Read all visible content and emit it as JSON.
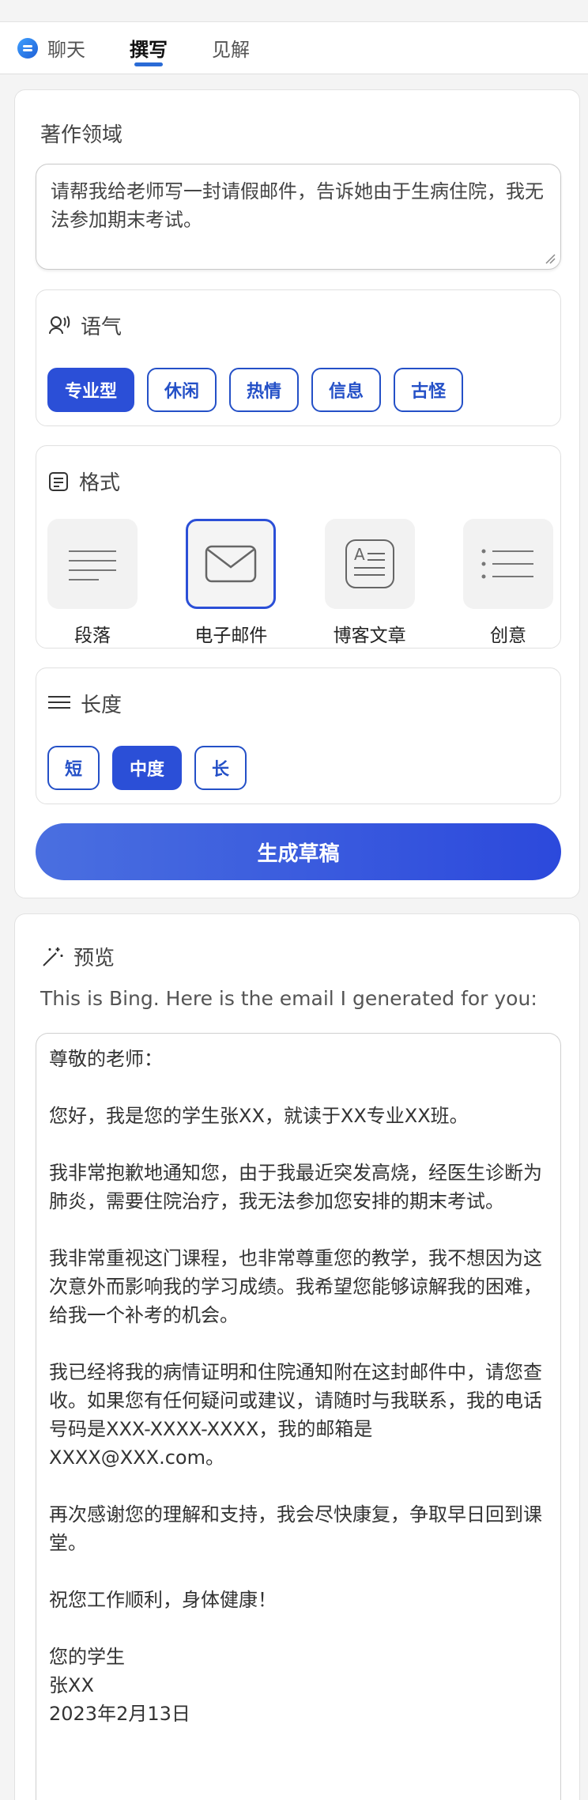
{
  "tabs": [
    {
      "label": "聊天",
      "icon": "chat-bubble-icon"
    },
    {
      "label": "撰写"
    },
    {
      "label": "见解"
    }
  ],
  "compose": {
    "topic_title": "著作领域",
    "topic_text": "请帮我给老师写一封请假邮件，告诉她由于生病住院，我无法参加期末考试。",
    "tone": {
      "title": "语气",
      "options": [
        "专业型",
        "休闲",
        "热情",
        "信息",
        "古怪"
      ],
      "selected": "专业型"
    },
    "format": {
      "title": "格式",
      "options": [
        {
          "label": "段落",
          "icon": "paragraph-icon"
        },
        {
          "label": "电子邮件",
          "icon": "email-icon"
        },
        {
          "label": "博客文章",
          "icon": "blog-post-icon"
        },
        {
          "label": "创意",
          "icon": "ideas-list-icon"
        }
      ],
      "selected": "电子邮件"
    },
    "length": {
      "title": "长度",
      "options": [
        "短",
        "中度",
        "长"
      ],
      "selected": "中度"
    },
    "generate_label": "生成草稿"
  },
  "preview": {
    "title": "预览",
    "intro": "This is Bing. Here is the email I generated for you:",
    "email": [
      "尊敬的老师：",
      "您好，我是您的学生张XX，就读于XX专业XX班。",
      "我非常抱歉地通知您，由于我最近突发高烧，经医生诊断为肺炎，需要住院治疗，我无法参加您安排的期末考试。",
      "我非常重视这门课程，也非常尊重您的教学，我不想因为这次意外而影响我的学习成绩。我希望您能够谅解我的困难，给我一个补考的机会。",
      "我已经将我的病情证明和住院通知附在这封邮件中，请您查收。如果您有任何疑问或建议，请随时与我联系，我的电话号码是XXX-XXXX-XXXX，我的邮箱是XXXX@XXX.com。",
      "再次感谢您的理解和支持，我会尽快康复，争取早日回到课堂。",
      "祝您工作顺利，身体健康！"
    ],
    "signature": [
      "您的学生",
      "张XX",
      "2023年2月13日"
    ]
  },
  "colors": {
    "accent": "#2b4fd7",
    "tab_indicator": "#2a6bd6"
  }
}
